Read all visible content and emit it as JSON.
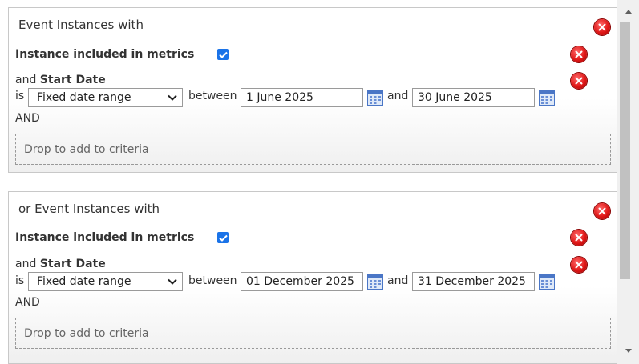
{
  "groups": [
    {
      "title": "Event Instances with",
      "criterion_label": "Instance included in metrics",
      "criterion_checked": true,
      "date_prefix": "and",
      "date_field": "Start Date",
      "is_label": "is",
      "range_type": "Fixed date range",
      "between_label": "between",
      "start_date": "1 June 2025",
      "and_label": "and",
      "end_date": "30 June 2025",
      "conjunction": "AND",
      "dropzone": "Drop to add to criteria"
    },
    {
      "title": "or Event Instances with",
      "criterion_label": "Instance included in metrics",
      "criterion_checked": true,
      "date_prefix": "and",
      "date_field": "Start Date",
      "is_label": "is",
      "range_type": "Fixed date range",
      "between_label": "between",
      "start_date": "01 December 2025",
      "and_label": "and",
      "end_date": "31 December 2025",
      "conjunction": "AND",
      "dropzone": "Drop to add to criteria"
    }
  ],
  "icons": {
    "remove": "remove-icon",
    "calendar": "calendar-icon",
    "dropdown": "chevron-down-icon",
    "check": "checkmark-icon"
  },
  "colors": {
    "checkbox": "#1a73e8",
    "remove_button": "#e01818",
    "calendar": "#4a76c6"
  }
}
